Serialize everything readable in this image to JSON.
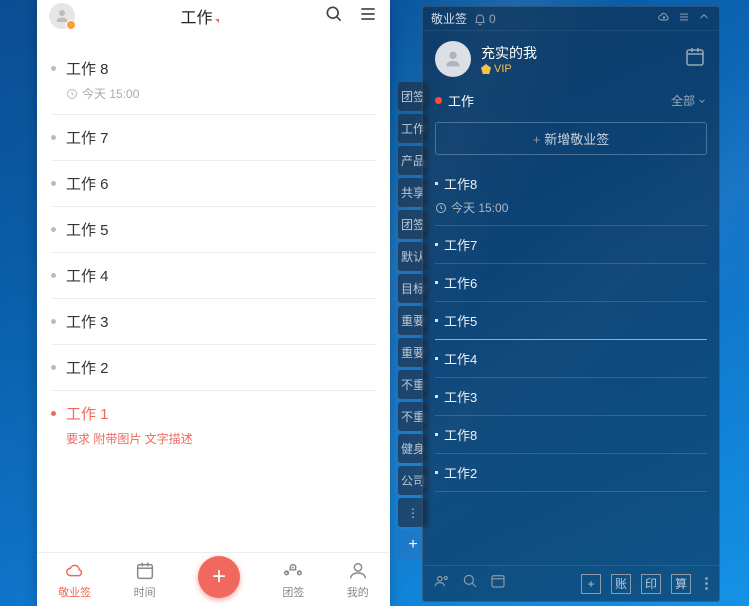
{
  "left": {
    "title": "工作",
    "items": [
      {
        "label": "工作 8",
        "time": "今天 15:00"
      },
      {
        "label": "工作 7"
      },
      {
        "label": "工作 6"
      },
      {
        "label": "工作 5"
      },
      {
        "label": "工作 4"
      },
      {
        "label": "工作 3"
      },
      {
        "label": "工作 2"
      },
      {
        "label": "工作 1",
        "sub": "要求  附带图片 文字描述",
        "red": true
      }
    ],
    "tabs": {
      "jy": "敬业签",
      "time": "时间",
      "team": "团签",
      "mine": "我的"
    }
  },
  "rail": {
    "tags": [
      "团签",
      "工作",
      "产品",
      "共享",
      "团签",
      "默认",
      "目标",
      "重要",
      "重要",
      "不重",
      "不重",
      "健身",
      "公司"
    ]
  },
  "right": {
    "app": "敬业签",
    "bell_count": "0",
    "user": {
      "name": "充实的我",
      "vip": "VIP"
    },
    "category": "工作",
    "all": "全部",
    "add": "新增敬业签",
    "items": [
      {
        "label": "工作8",
        "time": "今天 15:00"
      },
      {
        "label": "工作7"
      },
      {
        "label": "工作6"
      },
      {
        "label": "工作5",
        "hl": true
      },
      {
        "label": "工作4"
      },
      {
        "label": "工作3"
      },
      {
        "label": "工作8"
      },
      {
        "label": "工作2"
      }
    ],
    "btns": {
      "b1": "账",
      "b2": "印",
      "b3": "算"
    }
  }
}
